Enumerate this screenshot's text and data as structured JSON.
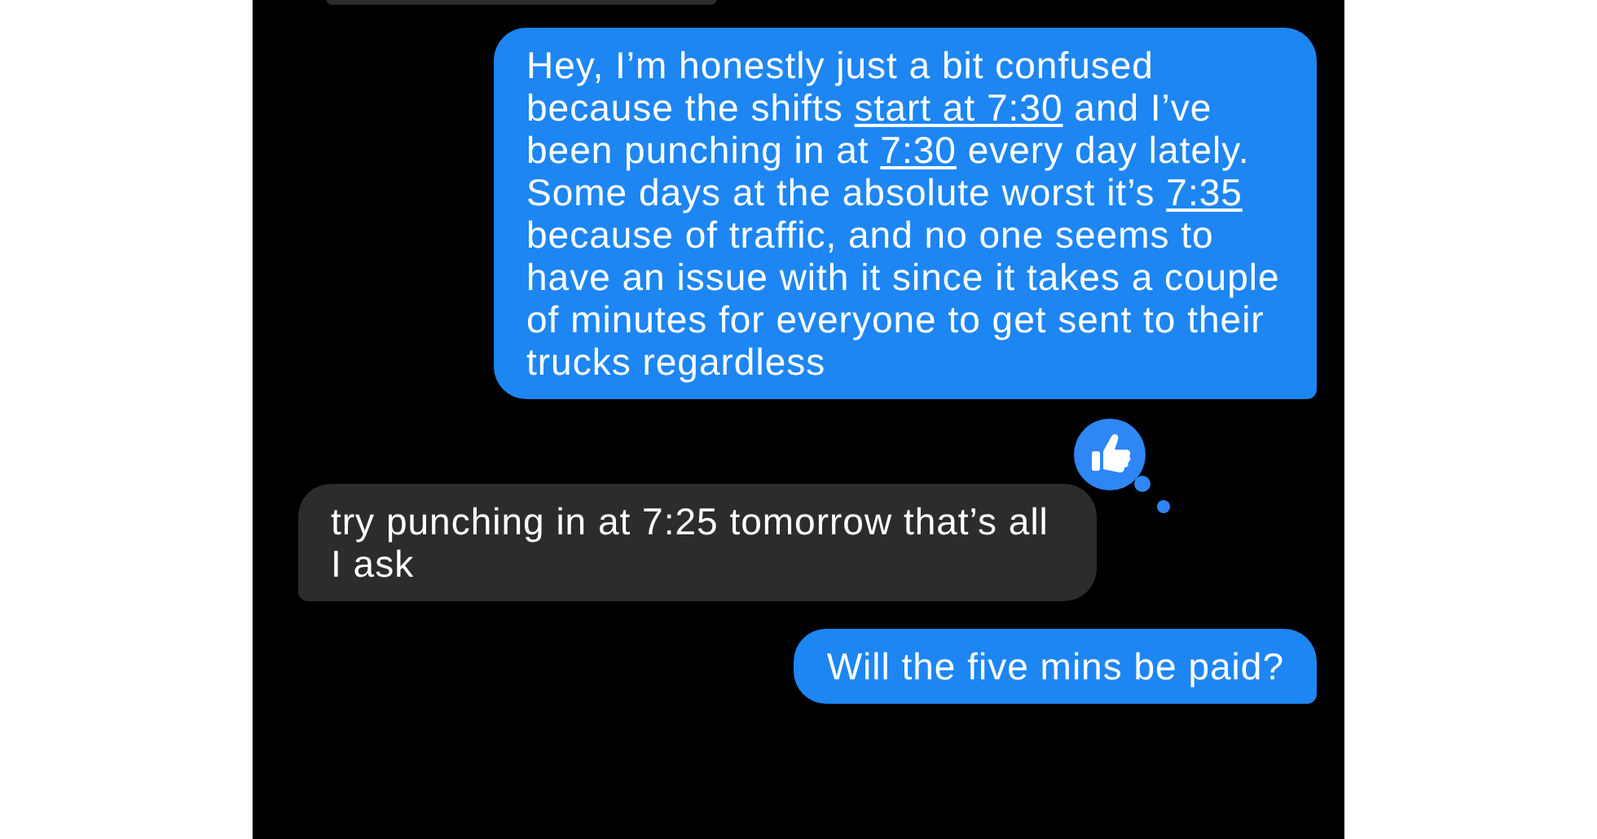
{
  "messages": [
    {
      "kind": "partial",
      "sent": false
    },
    {
      "kind": "text",
      "sent": true,
      "segments": [
        {
          "text": "Hey, I’m honestly just a bit confused because the shifts ",
          "underlined": false
        },
        {
          "text": "start at 7:30",
          "underlined": true
        },
        {
          "text": " and I’ve been punching in at ",
          "underlined": false
        },
        {
          "text": "7:30",
          "underlined": true
        },
        {
          "text": " every day lately. Some days at the absolute worst it’s ",
          "underlined": false
        },
        {
          "text": "7:35",
          "underlined": true
        },
        {
          "text": " because of traffic, and no one seems to have an issue with it since it takes a couple of minutes for everyone to get sent to their trucks regardless",
          "underlined": false
        }
      ]
    },
    {
      "kind": "text",
      "sent": false,
      "reaction": {
        "kind": "thumbs_up"
      },
      "segments": [
        {
          "text": "try punching in at 7:25 tomorrow that’s all I ask",
          "underlined": false
        }
      ]
    },
    {
      "kind": "text",
      "sent": true,
      "segments": [
        {
          "text": "Will the five mins be paid?",
          "underlined": false
        }
      ]
    }
  ]
}
